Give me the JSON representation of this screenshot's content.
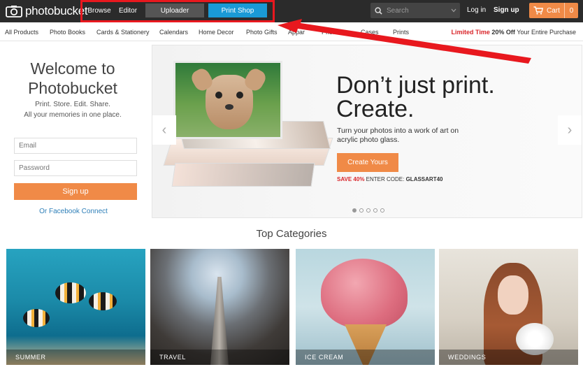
{
  "header": {
    "logo_text": "photobucket",
    "nav": [
      "Browse",
      "Editor"
    ],
    "uploader_label": "Uploader",
    "print_shop_label": "Print Shop",
    "search_placeholder": "Search",
    "login_label": "Log in",
    "signup_label": "Sign up",
    "cart_label": "Cart",
    "cart_count": "0"
  },
  "subnav": {
    "items": [
      "All Products",
      "Photo Books",
      "Cards & Stationery",
      "Calendars",
      "Home Decor",
      "Photo Gifts",
      "Appar",
      "Phone",
      "Cases",
      "Prints"
    ],
    "promo_red": "Limited Time",
    "promo_bold": "20% Off",
    "promo_rest": "Your Entire Purchase"
  },
  "welcome": {
    "title_line1": "Welcome to",
    "title_line2": "Photobucket",
    "tagline": "Print. Store. Edit. Share.",
    "subtitle": "All your memories in one place.",
    "email_placeholder": "Email",
    "password_placeholder": "Password",
    "signup_button": "Sign up",
    "facebook_link": "Or Facebook Connect"
  },
  "banner": {
    "headline_line1": "Don’t just print.",
    "headline_line2": "Create.",
    "description": "Turn your photos into a work of art on acrylic photo glass.",
    "cta_label": "Create Yours",
    "save_label": "SAVE 40%",
    "enter_code_label": "ENTER CODE:",
    "code": "GLASSART40",
    "prev_glyph": "‹",
    "next_glyph": "›",
    "slide_count": 5,
    "active_slide": 1
  },
  "categories": {
    "title": "Top Categories",
    "tiles": [
      {
        "label": "SUMMER"
      },
      {
        "label": "TRAVEL"
      },
      {
        "label": "ICE CREAM"
      },
      {
        "label": "WEDDINGS"
      }
    ]
  },
  "colors": {
    "brand_orange": "#f08a47",
    "header_bg": "#2b2b2b",
    "uploader_bg": "#555555",
    "print_shop_bg": "#1a9ad6",
    "annotation_red": "#e8181e",
    "promo_red": "#d9262b"
  },
  "icons": {
    "logo": "camera-logo-icon",
    "search": "search-icon",
    "chevron": "chevron-down-icon",
    "cart": "cart-icon"
  }
}
